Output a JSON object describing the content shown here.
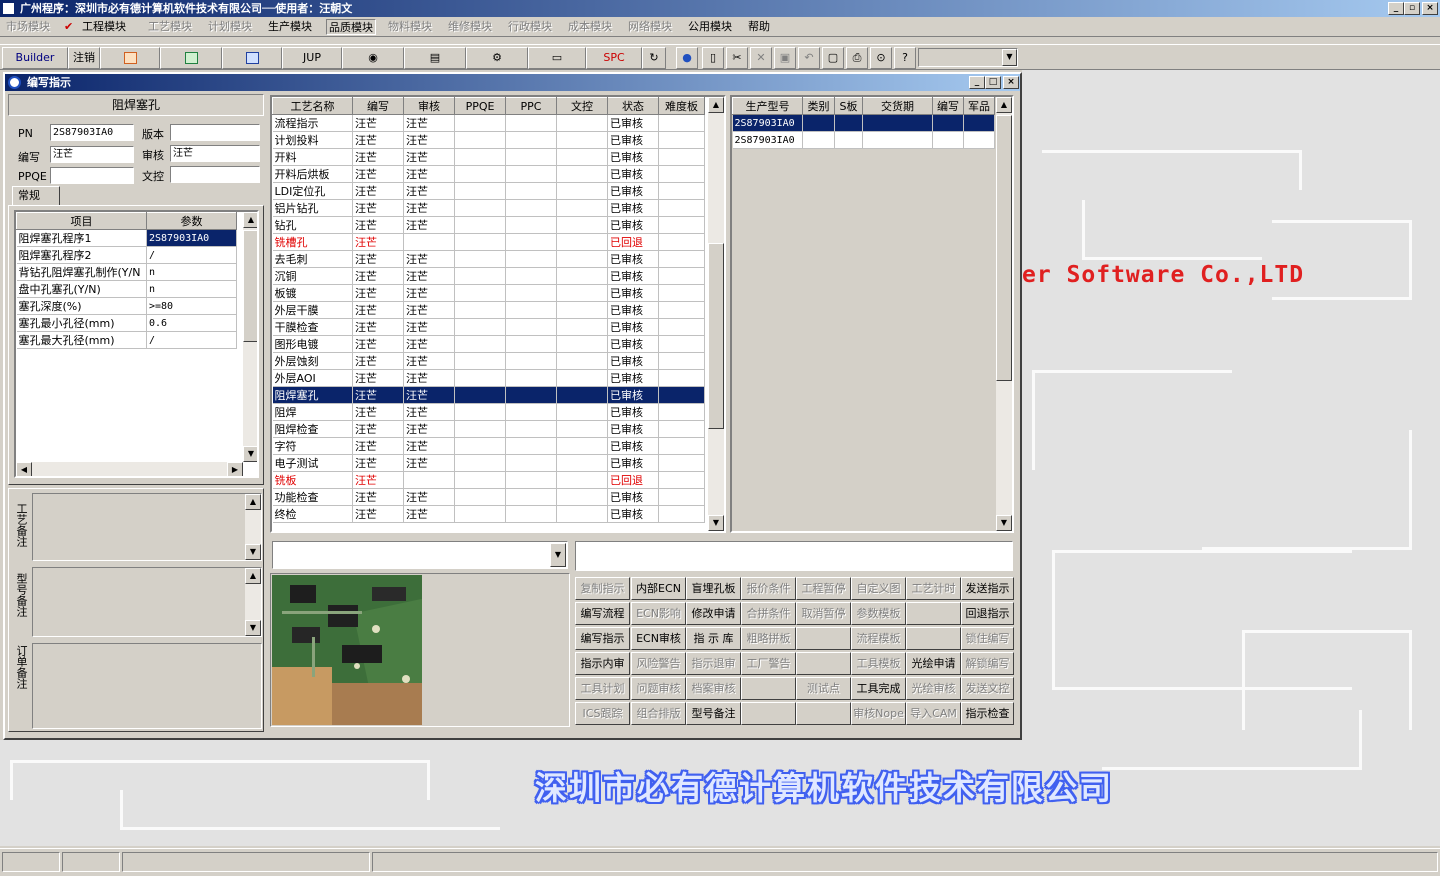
{
  "app": {
    "title": "广州程序：深圳市必有德计算机软件技术有限公司──使用者：汪朝文",
    "window_controls": [
      "_",
      "▫",
      "×"
    ]
  },
  "menu": [
    {
      "label": "市场模块",
      "enabled": false
    },
    {
      "label": "工程模块",
      "enabled": true,
      "checked": true
    },
    {
      "label": "工艺模块",
      "enabled": false
    },
    {
      "label": "计划模块",
      "enabled": false
    },
    {
      "label": "生产模块",
      "enabled": true
    },
    {
      "label": "品质模块",
      "enabled": true,
      "pressed": true
    },
    {
      "label": "物料模块",
      "enabled": false
    },
    {
      "label": "维修模块",
      "enabled": false
    },
    {
      "label": "行政模块",
      "enabled": false
    },
    {
      "label": "成本模块",
      "enabled": false
    },
    {
      "label": "网络模块",
      "enabled": false
    },
    {
      "label": "公用模块",
      "enabled": true
    },
    {
      "label": "帮助",
      "enabled": true
    }
  ],
  "toolbar": {
    "builder": "Builder",
    "logout": "注销",
    "jup": "JUP",
    "spc": "SPC"
  },
  "background": {
    "slogan": "er Software Co.,LTD",
    "company": "深圳市必有德计算机软件技术有限公司"
  },
  "dialog": {
    "title": "编写指示",
    "controls": [
      "_",
      "□",
      "×"
    ],
    "left": {
      "section_title": "阻焊塞孔",
      "pn_label": "PN",
      "pn_value": "2S87903IA0",
      "version_label": "版本",
      "version_value": "",
      "author_label": "编写",
      "author_value": "汪芒",
      "reviewer_label": "审核",
      "reviewer_value": "汪芒",
      "ppqe_label": "PPQE",
      "ppqe_value": "",
      "doc_label": "文控",
      "doc_value": "",
      "tab": "常规",
      "param_headers": [
        "项目",
        "参数"
      ],
      "params": [
        {
          "item": "阻焊塞孔程序1",
          "value": "2S87903IA0",
          "selected": true
        },
        {
          "item": "阻焊塞孔程序2",
          "value": "/"
        },
        {
          "item": "背钻孔阻焊塞孔制作(Y/N",
          "value": "n"
        },
        {
          "item": "盘中孔塞孔(Y/N)",
          "value": "n"
        },
        {
          "item": "塞孔深度(%)",
          "value": ">=80"
        },
        {
          "item": "塞孔最小孔径(mm)",
          "value": "0.6"
        },
        {
          "item": "塞孔最大孔径(mm)",
          "value": "/"
        }
      ],
      "note_labels": [
        "工艺备注",
        "型号备注",
        "订单备注"
      ]
    },
    "process": {
      "headers": [
        "工艺名称",
        "编写",
        "审核",
        "PPQE",
        "PPC",
        "文控",
        "状态",
        "难度板"
      ],
      "rows": [
        {
          "name": "流程指示",
          "author": "汪芒",
          "reviewer": "汪芒",
          "status": "已审核"
        },
        {
          "name": "计划投料",
          "author": "汪芒",
          "reviewer": "汪芒",
          "status": "已审核"
        },
        {
          "name": "开料",
          "author": "汪芒",
          "reviewer": "汪芒",
          "status": "已审核"
        },
        {
          "name": "开料后烘板",
          "author": "汪芒",
          "reviewer": "汪芒",
          "status": "已审核"
        },
        {
          "name": "LDI定位孔",
          "author": "汪芒",
          "reviewer": "汪芒",
          "status": "已审核"
        },
        {
          "name": "铝片钻孔",
          "author": "汪芒",
          "reviewer": "汪芒",
          "status": "已审核"
        },
        {
          "name": "钻孔",
          "author": "汪芒",
          "reviewer": "汪芒",
          "status": "已审核"
        },
        {
          "name": "铣槽孔",
          "author": "汪芒",
          "reviewer": "",
          "status": "已回退",
          "red": true
        },
        {
          "name": "去毛刺",
          "author": "汪芒",
          "reviewer": "汪芒",
          "status": "已审核"
        },
        {
          "name": "沉铜",
          "author": "汪芒",
          "reviewer": "汪芒",
          "status": "已审核"
        },
        {
          "name": "板镀",
          "author": "汪芒",
          "reviewer": "汪芒",
          "status": "已审核"
        },
        {
          "name": "外层干膜",
          "author": "汪芒",
          "reviewer": "汪芒",
          "status": "已审核"
        },
        {
          "name": "干膜检查",
          "author": "汪芒",
          "reviewer": "汪芒",
          "status": "已审核"
        },
        {
          "name": "图形电镀",
          "author": "汪芒",
          "reviewer": "汪芒",
          "status": "已审核"
        },
        {
          "name": "外层蚀刻",
          "author": "汪芒",
          "reviewer": "汪芒",
          "status": "已审核"
        },
        {
          "name": "外层AOI",
          "author": "汪芒",
          "reviewer": "汪芒",
          "status": "已审核"
        },
        {
          "name": "阻焊塞孔",
          "author": "汪芒",
          "reviewer": "汪芒",
          "status": "已审核",
          "selected": true
        },
        {
          "name": "阻焊",
          "author": "汪芒",
          "reviewer": "汪芒",
          "status": "已审核"
        },
        {
          "name": "阻焊检查",
          "author": "汪芒",
          "reviewer": "汪芒",
          "status": "已审核"
        },
        {
          "name": "字符",
          "author": "汪芒",
          "reviewer": "汪芒",
          "status": "已审核"
        },
        {
          "name": "电子测试",
          "author": "汪芒",
          "reviewer": "汪芒",
          "status": "已审核"
        },
        {
          "name": "铣板",
          "author": "汪芒",
          "reviewer": "",
          "status": "已回退",
          "red": true
        },
        {
          "name": "功能检查",
          "author": "汪芒",
          "reviewer": "汪芒",
          "status": "已审核"
        },
        {
          "name": "终检",
          "author": "汪芒",
          "reviewer": "汪芒",
          "status": "已审核"
        }
      ]
    },
    "models": {
      "headers": [
        "生产型号",
        "类别",
        "S板",
        "交货期",
        "编写",
        "军品"
      ],
      "rows": [
        {
          "model": "2S87903IA0",
          "selected": true
        },
        {
          "model": "2S87903IA0"
        }
      ]
    },
    "buttons": [
      [
        {
          "l": "复制指示",
          "e": false
        },
        {
          "l": "内部ECN",
          "e": true
        },
        {
          "l": "盲埋孔板",
          "e": true
        },
        {
          "l": "报价条件",
          "e": false
        },
        {
          "l": "工程暂停",
          "e": false
        },
        {
          "l": "自定义图",
          "e": false
        },
        {
          "l": "工艺计时",
          "e": false
        },
        {
          "l": "发送指示",
          "e": true
        }
      ],
      [
        {
          "l": "编写流程",
          "e": true
        },
        {
          "l": "ECN影响",
          "e": false
        },
        {
          "l": "修改申请",
          "e": true
        },
        {
          "l": "合拼条件",
          "e": false
        },
        {
          "l": "取消暂停",
          "e": false
        },
        {
          "l": "参数模板",
          "e": false
        },
        {
          "l": "",
          "e": false
        },
        {
          "l": "回退指示",
          "e": true
        }
      ],
      [
        {
          "l": "编写指示",
          "e": true
        },
        {
          "l": "ECN审核",
          "e": true
        },
        {
          "l": "指 示 库",
          "e": true
        },
        {
          "l": "粗略拼板",
          "e": false
        },
        {
          "l": "",
          "e": false
        },
        {
          "l": "流程模板",
          "e": false
        },
        {
          "l": "",
          "e": false
        },
        {
          "l": "锁住编写",
          "e": false
        }
      ],
      [
        {
          "l": "指示内审",
          "e": true
        },
        {
          "l": "风险警告",
          "e": false
        },
        {
          "l": "指示退审",
          "e": false
        },
        {
          "l": "工厂警告",
          "e": false
        },
        {
          "l": "",
          "e": false
        },
        {
          "l": "工具模板",
          "e": false
        },
        {
          "l": "光绘申请",
          "e": true
        },
        {
          "l": "解锁编写",
          "e": false
        }
      ],
      [
        {
          "l": "工具计划",
          "e": false
        },
        {
          "l": "问题审核",
          "e": false
        },
        {
          "l": "档案审核",
          "e": false
        },
        {
          "l": "",
          "e": false
        },
        {
          "l": "测试点",
          "e": false
        },
        {
          "l": "工具完成",
          "e": true
        },
        {
          "l": "光绘审核",
          "e": false
        },
        {
          "l": "发送文控",
          "e": false
        }
      ],
      [
        {
          "l": "ICS跟踪",
          "e": false
        },
        {
          "l": "组合排版",
          "e": false
        },
        {
          "l": "型号备注",
          "e": true
        },
        {
          "l": "",
          "e": false
        },
        {
          "l": "",
          "e": false
        },
        {
          "l": "审核Nope",
          "e": false
        },
        {
          "l": "导入CAM",
          "e": false
        },
        {
          "l": "指示检查",
          "e": true
        }
      ]
    ]
  }
}
